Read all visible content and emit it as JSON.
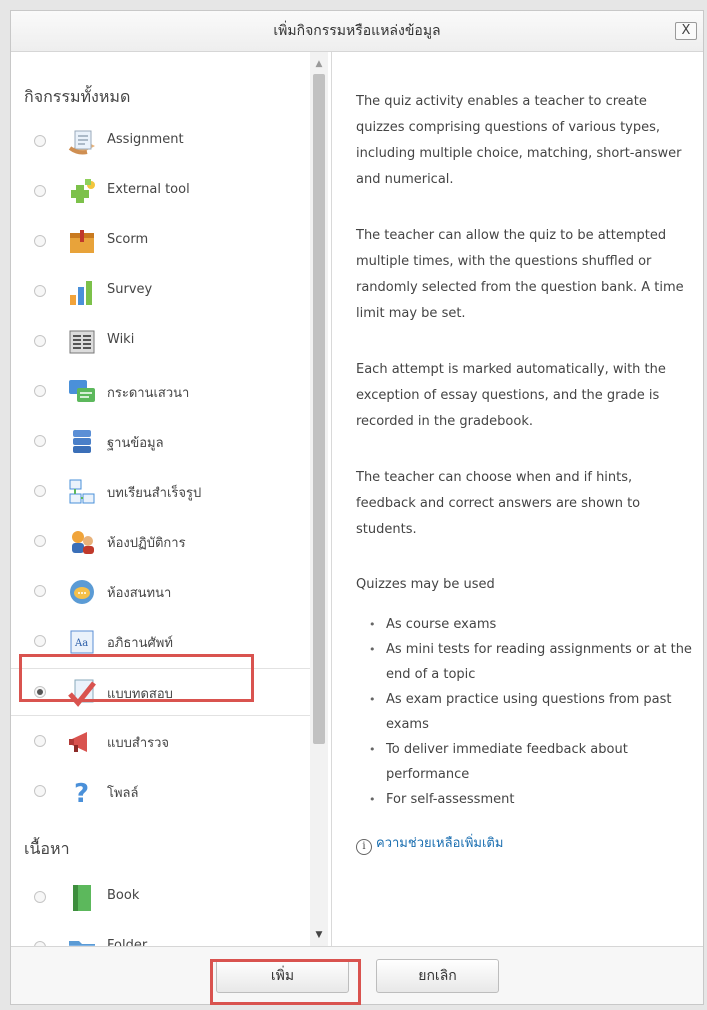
{
  "dialog": {
    "title": "เพิ่มกิจกรรมหรือแหล่งข้อมูล",
    "close_label": "X"
  },
  "left": {
    "activities_heading": "กิจกรรมทั้งหมด",
    "activities": [
      {
        "label": "Assignment",
        "icon": "assignment-icon",
        "selected": false
      },
      {
        "label": "External tool",
        "icon": "external-tool-icon",
        "selected": false
      },
      {
        "label": "Scorm",
        "icon": "scorm-icon",
        "selected": false
      },
      {
        "label": "Survey",
        "icon": "survey-icon",
        "selected": false
      },
      {
        "label": "Wiki",
        "icon": "wiki-icon",
        "selected": false
      },
      {
        "label": "กระดานเสวนา",
        "icon": "forum-icon",
        "selected": false
      },
      {
        "label": "ฐานข้อมูล",
        "icon": "database-icon",
        "selected": false
      },
      {
        "label": "บทเรียนสำเร็จรูป",
        "icon": "lesson-icon",
        "selected": false
      },
      {
        "label": "ห้องปฏิบัติการ",
        "icon": "workshop-icon",
        "selected": false
      },
      {
        "label": "ห้องสนทนา",
        "icon": "chat-icon",
        "selected": false
      },
      {
        "label": "อภิธานศัพท์",
        "icon": "glossary-icon",
        "selected": false
      },
      {
        "label": "แบบทดสอบ",
        "icon": "quiz-icon",
        "selected": true
      },
      {
        "label": "แบบสำรวจ",
        "icon": "feedback-icon",
        "selected": false
      },
      {
        "label": "โพลล์",
        "icon": "choice-icon",
        "selected": false
      }
    ],
    "resources_heading": "เนื้อหา",
    "resources": [
      {
        "label": "Book",
        "icon": "book-icon",
        "selected": false
      },
      {
        "label": "Folder",
        "icon": "folder-icon",
        "selected": false
      }
    ]
  },
  "help": {
    "paragraphs": [
      "The quiz activity enables a teacher to create quizzes comprising questions of various types, including multiple choice, matching, short-answer and numerical.",
      "The teacher can allow the quiz to be attempted multiple times, with the questions shuffled or randomly selected from the question bank. A time limit may be set.",
      "Each attempt is marked automatically, with the exception of essay questions, and the grade is recorded in the gradebook.",
      "The teacher can choose when and if hints, feedback and correct answers are shown to students.",
      "Quizzes may be used"
    ],
    "bullets": [
      "As course exams",
      "As mini tests for reading assignments or at the end of a topic",
      "As exam practice using questions from past exams",
      "To deliver immediate feedback about performance",
      "For self-assessment"
    ],
    "more_help_label": "ความช่วยเหลือเพิ่มเติม"
  },
  "footer": {
    "add_label": "เพิ่ม",
    "cancel_label": "ยกเลิก"
  },
  "colors": {
    "highlight": "#d9534f",
    "link": "#1a6eb0"
  }
}
